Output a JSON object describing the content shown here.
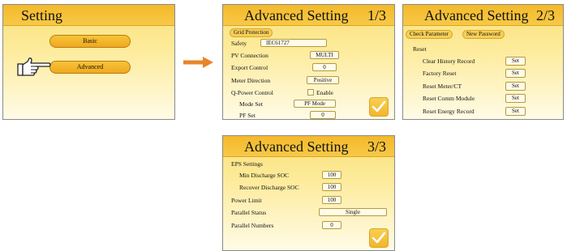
{
  "setting": {
    "title": "Setting",
    "basic": "Basic",
    "advanced": "Advanced"
  },
  "adv1": {
    "title": "Advanced Setting",
    "page": "1/3",
    "grid_protection": "Grid Protection",
    "safety_label": "Safety",
    "safety_value": "IEC61727",
    "pv_connection_label": "PV Connection",
    "pv_connection_value": "MULTI",
    "export_control_label": "Export Control",
    "export_control_value": "0",
    "meter_direction_label": "Meter Direction",
    "meter_direction_value": "Positive",
    "q_power_label": "Q-Power Control",
    "enable_label": "Enable",
    "mode_set_label": "Mode Set",
    "mode_set_value": "PF Mode",
    "pf_set_label": "PF Set",
    "pf_set_value": "0"
  },
  "adv2": {
    "title": "Advanced Setting",
    "page": "2/3",
    "check_parameter": "Check Parameter",
    "new_password": "New Password",
    "reset_heading": "Reset",
    "items": [
      {
        "label": "Clear History Record",
        "button": "Set"
      },
      {
        "label": "Factory Reset",
        "button": "Set"
      },
      {
        "label": "Reset Meter/CT",
        "button": "Set"
      },
      {
        "label": "Reset Comm Module",
        "button": "Set"
      },
      {
        "label": "Reset Energy Record",
        "button": "Set"
      }
    ]
  },
  "adv3": {
    "title": "Advanced Setting",
    "page": "3/3",
    "eps_heading": "EPS Settings",
    "min_discharge_label": "Min Discharge SOC",
    "min_discharge_value": "100",
    "recover_discharge_label": "Recover Discharge SOC",
    "recover_discharge_value": "100",
    "power_limit_label": "Power Limit",
    "power_limit_value": "100",
    "parallel_status_label": "Parallel Status",
    "parallel_status_value": "Single",
    "parallel_numbers_label": "Parallel Numbers",
    "parallel_numbers_value": "0"
  },
  "colors": {
    "panel_top": "#fbe07a",
    "title_bar": "#f4b92a",
    "arrow": "#e8842a",
    "check": "#ffffff"
  },
  "icons": {
    "pointer": "hand-pointer-icon",
    "arrow": "arrow-right-icon",
    "confirm": "checkmark-icon"
  }
}
